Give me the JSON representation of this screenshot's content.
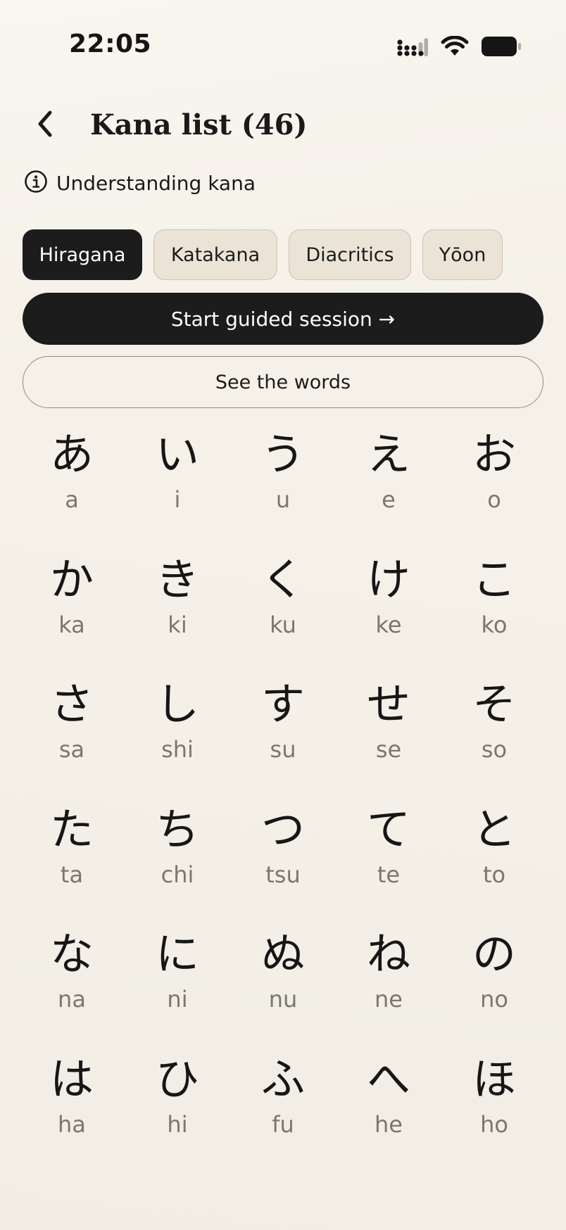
{
  "status_bar": {
    "time": "22:05",
    "icons": [
      "signal-icon",
      "wifi-icon",
      "battery-icon"
    ]
  },
  "header": {
    "back_icon": "chevron-left-icon",
    "title": "Kana list (46)"
  },
  "info": {
    "icon": "info-circle-icon",
    "label": "Understanding kana"
  },
  "tabs": [
    {
      "label": "Hiragana",
      "active": true
    },
    {
      "label": "Katakana",
      "active": false
    },
    {
      "label": "Diacritics",
      "active": false
    },
    {
      "label": "Yōon",
      "active": false
    }
  ],
  "actions": {
    "primary_label": "Start guided session →",
    "secondary_label": "See the words"
  },
  "kana": [
    {
      "char": "あ",
      "romaji": "a"
    },
    {
      "char": "い",
      "romaji": "i"
    },
    {
      "char": "う",
      "romaji": "u"
    },
    {
      "char": "え",
      "romaji": "e"
    },
    {
      "char": "お",
      "romaji": "o"
    },
    {
      "char": "か",
      "romaji": "ka"
    },
    {
      "char": "き",
      "romaji": "ki"
    },
    {
      "char": "く",
      "romaji": "ku"
    },
    {
      "char": "け",
      "romaji": "ke"
    },
    {
      "char": "こ",
      "romaji": "ko"
    },
    {
      "char": "さ",
      "romaji": "sa"
    },
    {
      "char": "し",
      "romaji": "shi"
    },
    {
      "char": "す",
      "romaji": "su"
    },
    {
      "char": "せ",
      "romaji": "se"
    },
    {
      "char": "そ",
      "romaji": "so"
    },
    {
      "char": "た",
      "romaji": "ta"
    },
    {
      "char": "ち",
      "romaji": "chi"
    },
    {
      "char": "つ",
      "romaji": "tsu"
    },
    {
      "char": "て",
      "romaji": "te"
    },
    {
      "char": "と",
      "romaji": "to"
    },
    {
      "char": "な",
      "romaji": "na"
    },
    {
      "char": "に",
      "romaji": "ni"
    },
    {
      "char": "ぬ",
      "romaji": "nu"
    },
    {
      "char": "ね",
      "romaji": "ne"
    },
    {
      "char": "の",
      "romaji": "no"
    },
    {
      "char": "は",
      "romaji": "ha"
    },
    {
      "char": "ひ",
      "romaji": "hi"
    },
    {
      "char": "ふ",
      "romaji": "fu"
    },
    {
      "char": "へ",
      "romaji": "he"
    },
    {
      "char": "ほ",
      "romaji": "ho"
    }
  ],
  "colors": {
    "background": "#f5f1e8",
    "primary": "#1c1c1c",
    "tab_inactive": "#ebe4d6",
    "romaji": "#7a7770"
  }
}
